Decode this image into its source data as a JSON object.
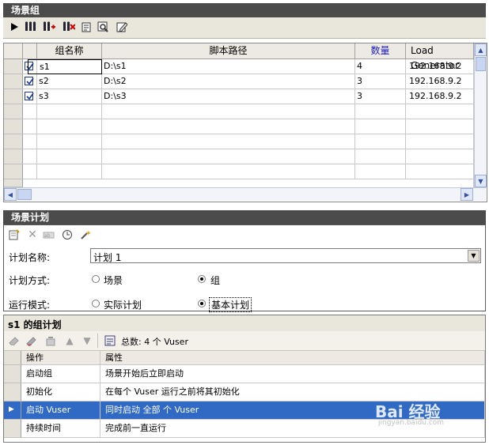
{
  "scenario_groups": {
    "title": "场景组",
    "columns": [
      "组名称",
      "脚本路径",
      "数量",
      "Load Generator"
    ],
    "rows": [
      {
        "name": "s1",
        "path": "D:\\s1",
        "count": "4",
        "lg": "192.168.9.2"
      },
      {
        "name": "s2",
        "path": "D:\\s2",
        "count": "3",
        "lg": "192.168.9.2"
      },
      {
        "name": "s3",
        "path": "D:\\s3",
        "count": "3",
        "lg": "192.168.9.2"
      }
    ]
  },
  "scenario_schedule": {
    "title": "场景计划",
    "plan_name_label": "计划名称:",
    "plan_name_value": "计划 1",
    "plan_mode_label": "计划方式:",
    "plan_mode_scene": "场景",
    "plan_mode_group": "组",
    "run_mode_label": "运行模式:",
    "run_mode_actual": "实际计划",
    "run_mode_basic": "基本计划"
  },
  "group_schedule": {
    "title": "s1 的组计划",
    "total_text": "总数: 4 个 Vuser",
    "col_action": "操作",
    "col_property": "属性",
    "rows": [
      {
        "action": "启动组",
        "property": "场景开始后立即启动"
      },
      {
        "action": "初始化",
        "property": "在每个 Vuser 运行之前将其初始化"
      },
      {
        "action": "启动 Vuser",
        "property": "同时启动 全部 个 Vuser"
      },
      {
        "action": "持续时间",
        "property": "完成前一直运行"
      }
    ]
  },
  "watermark": {
    "brand": "Bai 经验",
    "url": "jingyan.baidu.com"
  },
  "colors": {
    "titlebar": "#4b4b4b",
    "selected_row": "#316ac5",
    "count_header": "#1f1fbf"
  }
}
